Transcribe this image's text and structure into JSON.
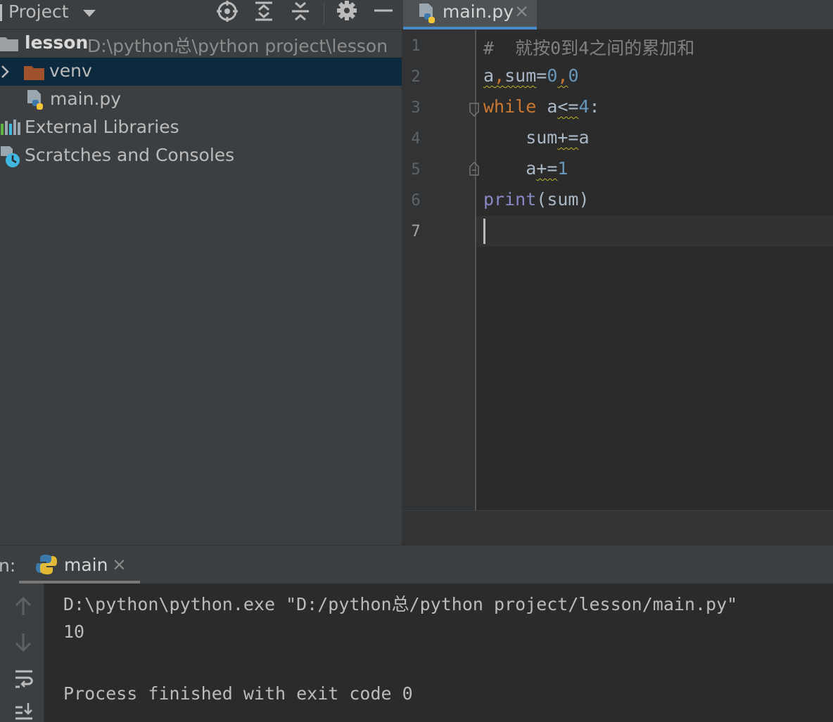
{
  "project_panel": {
    "title": "Project",
    "root": {
      "name": "lesson",
      "path": "D:\\python总\\python project\\lesson"
    },
    "items": [
      {
        "label": "venv",
        "type": "folder"
      },
      {
        "label": "main.py",
        "type": "python-file"
      },
      {
        "label": "External Libraries",
        "type": "libraries"
      },
      {
        "label": "Scratches and Consoles",
        "type": "scratches"
      }
    ]
  },
  "editor": {
    "tab": {
      "label": "main.py",
      "close": "×"
    },
    "line_numbers": [
      "1",
      "2",
      "3",
      "4",
      "5",
      "6",
      "7"
    ],
    "current_line": "7",
    "code": {
      "l1_comment": "#  就按0到4之间的累加和",
      "l2_a": "a",
      "l2_comma1": ",",
      "l2_sum": "sum",
      "l2_eq": "=",
      "l2_zero1": "0",
      "l2_comma2": ",",
      "l2_zero2": "0",
      "l3_while": "while",
      "l3_a": " a",
      "l3_op": "<=",
      "l3_four": "4",
      "l3_colon": ":",
      "l4_sum": "    sum",
      "l4_op": "+=",
      "l4_a": "a",
      "l5_a": "    a",
      "l5_op": "+=",
      "l5_one": "1",
      "l6_print": "print",
      "l6_args": "(sum)"
    }
  },
  "run_panel": {
    "prefix": "n:",
    "tab": {
      "label": "main",
      "close": "×"
    },
    "console_lines": [
      "D:\\python\\python.exe \"D:/python总/python project/lesson/main.py\"",
      "10",
      "",
      "Process finished with exit code 0"
    ]
  },
  "icons": {
    "project_toolbar": [
      "locate-icon",
      "expand-all-icon",
      "collapse-all-icon",
      "settings-gear-icon",
      "hide-minus-icon"
    ],
    "run_toolbar": [
      "arrow-up-icon",
      "arrow-down-icon",
      "soft-wrap-icon",
      "scroll-to-end-icon"
    ]
  },
  "colors": {
    "keyword": "#cc7832",
    "number": "#6897bb",
    "builtin": "#8888c6",
    "comment": "#808080",
    "selection": "#0d293e",
    "tab_accent": "#4a88c7"
  }
}
